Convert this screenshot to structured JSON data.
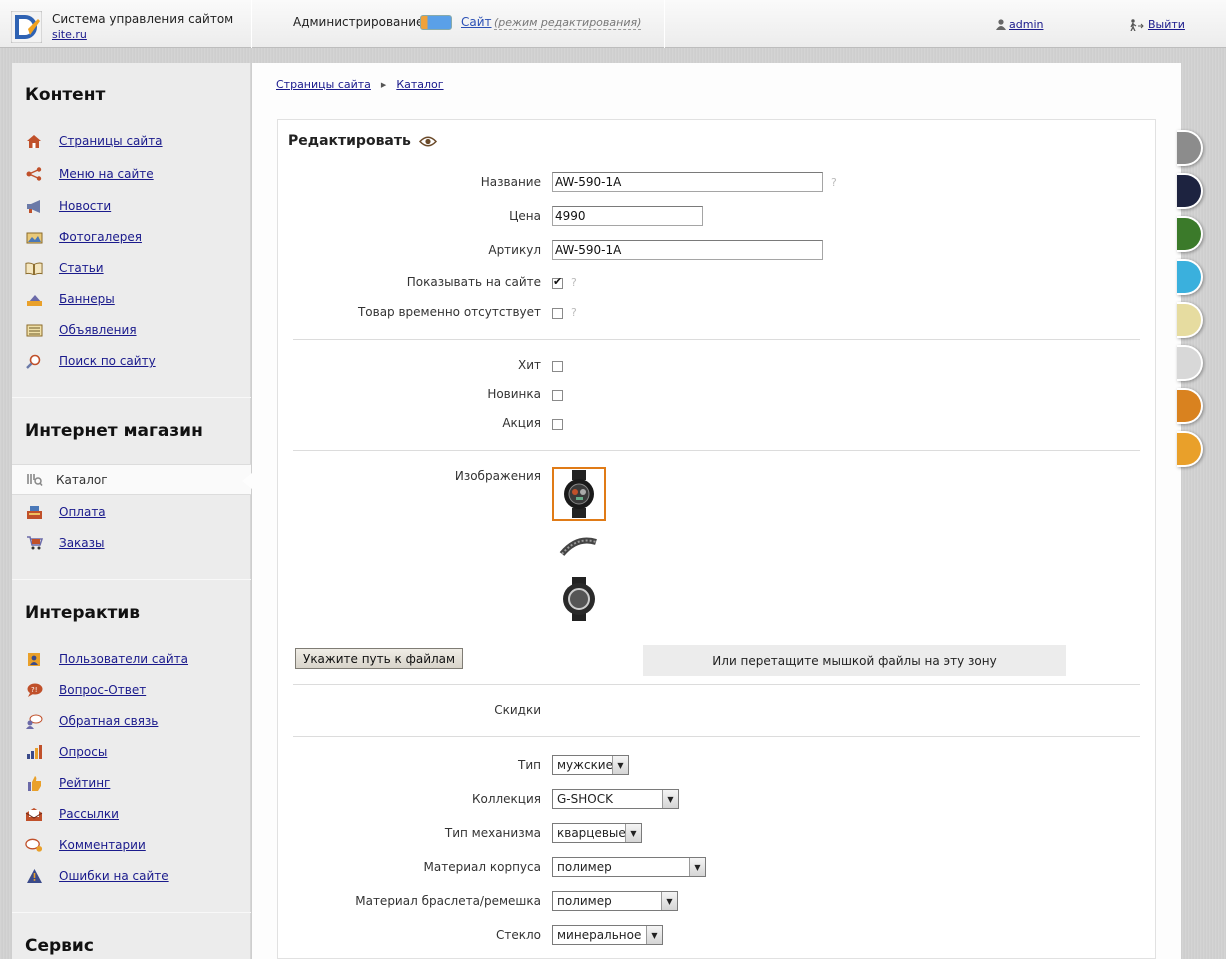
{
  "header": {
    "brand_title": "Система управления сайтом",
    "brand_site": "site.ru",
    "admin_label": "Администрирование",
    "site_label": "Сайт",
    "edit_mode": "(режим редактирования)",
    "user": "admin",
    "logout": "Выйти"
  },
  "sidebar": {
    "content_title": "Контент",
    "content_items": [
      {
        "label": "Страницы сайта",
        "icon": "home-icon"
      },
      {
        "label": "Меню на сайте",
        "icon": "share-icon"
      },
      {
        "label": "Новости",
        "icon": "megaphone-icon"
      },
      {
        "label": "Фотогалерея",
        "icon": "photo-icon"
      },
      {
        "label": "Статьи",
        "icon": "book-icon"
      },
      {
        "label": "Баннеры",
        "icon": "banner-icon"
      },
      {
        "label": "Объявления",
        "icon": "board-icon"
      },
      {
        "label": "Поиск по сайту",
        "icon": "search-icon"
      }
    ],
    "shop_title": "Интернет магазин",
    "shop_items": [
      {
        "label": "Каталог",
        "icon": "catalog-icon",
        "active": true
      },
      {
        "label": "Оплата",
        "icon": "cash-register-icon"
      },
      {
        "label": "Заказы",
        "icon": "cart-icon"
      }
    ],
    "interactive_title": "Интерактив",
    "interactive_items": [
      {
        "label": "Пользователи сайта",
        "icon": "users-icon"
      },
      {
        "label": "Вопрос-Ответ",
        "icon": "question-icon"
      },
      {
        "label": "Обратная связь",
        "icon": "feedback-icon"
      },
      {
        "label": "Опросы",
        "icon": "poll-icon"
      },
      {
        "label": "Рейтинг",
        "icon": "thumb-icon"
      },
      {
        "label": "Рассылки",
        "icon": "mail-icon"
      },
      {
        "label": "Комментарии",
        "icon": "comments-icon"
      },
      {
        "label": "Ошибки на сайте",
        "icon": "warning-icon"
      }
    ],
    "service_title": "Сервис"
  },
  "breadcrumb": [
    "Страницы сайта",
    "Каталог"
  ],
  "form": {
    "title": "Редактировать",
    "name_label": "Название",
    "name_value": "AW-590-1A",
    "price_label": "Цена",
    "price_value": "4990",
    "sku_label": "Артикул",
    "sku_value": "AW-590-1A",
    "show_label": "Показывать на сайте",
    "show_checked": true,
    "absent_label": "Товар временно отсутствует",
    "absent_checked": false,
    "help_mark": "?",
    "hit_label": "Хит",
    "new_label": "Новинка",
    "promo_label": "Акция",
    "images_label": "Изображения",
    "upload_button": "Укажите путь к файлам",
    "dropzone_text": "Или перетащите мышкой файлы на эту зону",
    "discounts_label": "Скидки",
    "type_label": "Тип",
    "type_value": "мужские",
    "collection_label": "Коллекция",
    "collection_value": "G-SHOCK",
    "mechanism_label": "Тип механизма",
    "mechanism_value": "кварцевые",
    "case_label": "Материал корпуса",
    "case_value": "полимер",
    "strap_label": "Материал браслета/ремешка",
    "strap_value": "полимер",
    "glass_label": "Стекло",
    "glass_value": "минеральное"
  },
  "theme_colors": [
    "#8c8c8c",
    "#1d2340",
    "#3b7a2a",
    "#3ab0dd",
    "#e6dca0",
    "#d8d8d8",
    "#d9821f",
    "#e9a02a"
  ]
}
